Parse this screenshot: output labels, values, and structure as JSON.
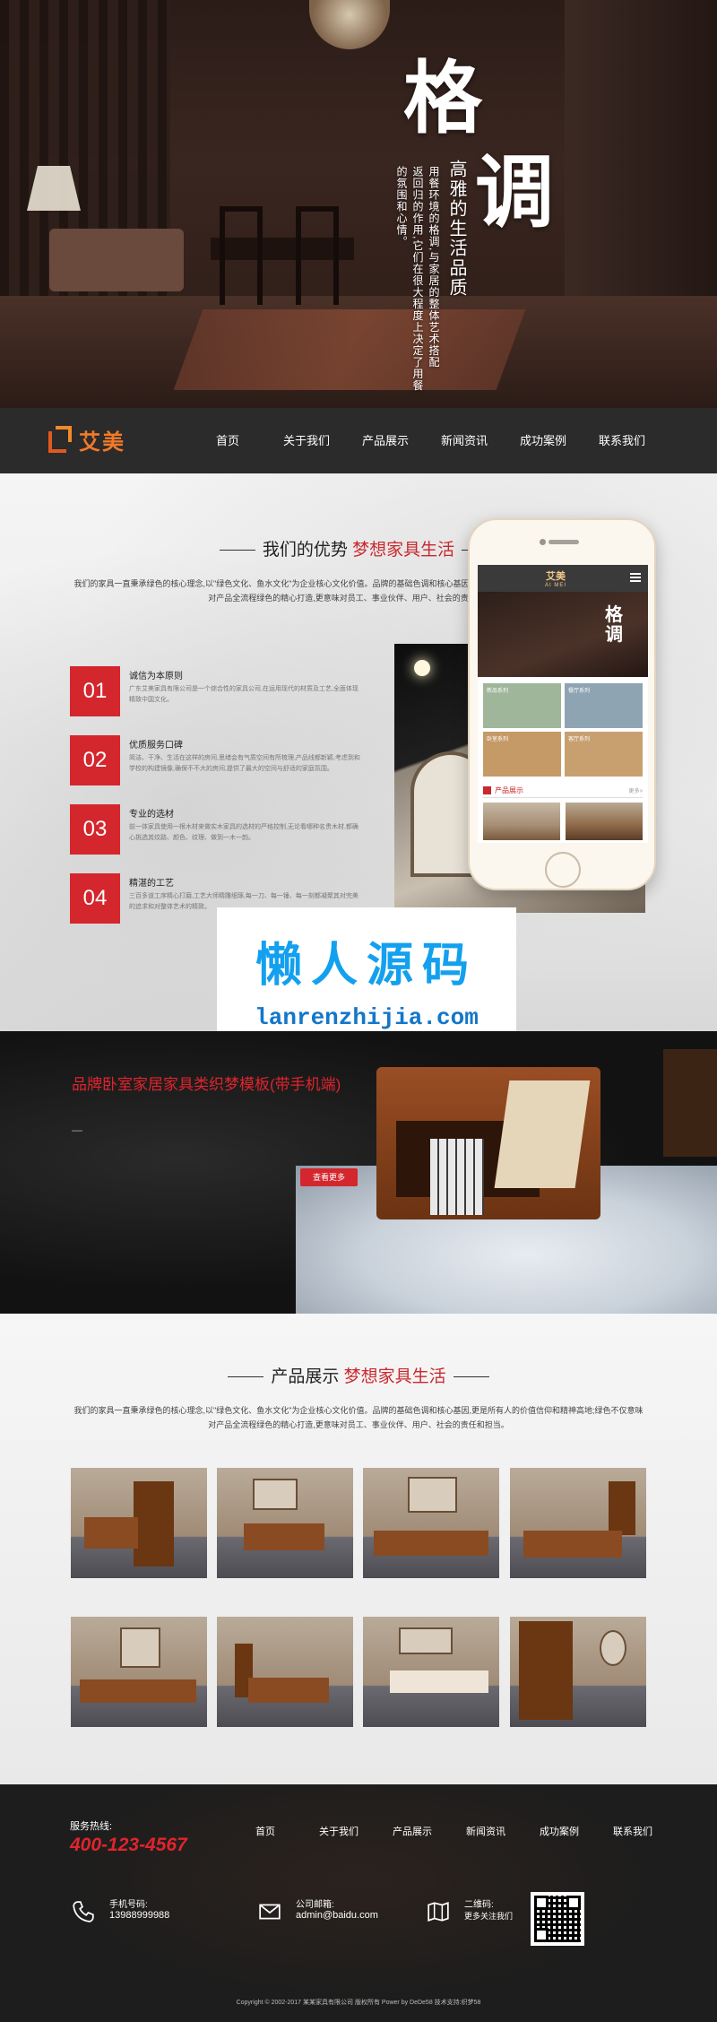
{
  "hero": {
    "title_char_1": "格",
    "title_char_2": "调",
    "subtitle": "高雅的生活品质",
    "text_lines": [
      "用餐环境的格调,与家居的整体艺术搭配",
      "返回归的作用,它们在很大程度上决定了用餐",
      "的氛围和心情。"
    ]
  },
  "nav": {
    "logo_text": "艾美",
    "items": [
      "首页",
      "关于我们",
      "产品展示",
      "新闻资讯",
      "成功案例",
      "联系我们"
    ]
  },
  "advantage": {
    "heading_main": "我们的优势",
    "heading_accent": "梦想家具生活",
    "intro": "我们的家具一直秉承绿色的核心理念,以\"绿色文化、鱼水文化\"为企业核心文化价值。品牌的基础色调和核心基因,更是所有人的价值信仰和精神高地;绿色不仅意味对产品全流程绿色的精心打造,更意味对员工、事业伙伴、用户、社会的责任和担当。",
    "features": [
      {
        "num": "01",
        "title": "诚信为本原则",
        "desc": "广东艾美家具有限公司是一个综合性的家具公司,在运用现代的材质及工艺,全面体现精致中国文化。"
      },
      {
        "num": "02",
        "title": "优质服务口碑",
        "desc": "简洁、干净、生活在这样的房间,思绪会有气质空间有所梳理,产品线都新颖,考虑到和学校的构建镜像,确保不不大的房间,提供了最大的空间与舒适的家庭氛围。"
      },
      {
        "num": "03",
        "title": "专业的选材",
        "desc": "前一体家具使用一根木材来做实木家具的选材的严格控制,无论看哪种名贵木材,都确心挑选其纹路、颜色、纹理、做到一木一韵。"
      },
      {
        "num": "04",
        "title": "精湛的工艺",
        "desc": "三百多道工序精心打磨,工艺大师精雕细琢,每一刀、每一锤、每一刻都凝聚其对完美的追求和对整体艺术的精致。"
      }
    ]
  },
  "phone": {
    "logo": "艾美",
    "logo_sub": "AI MEI",
    "hero_text": "格调",
    "tiles": [
      "新品系列",
      "餐厅系列",
      "卧室系列",
      "客厅系列"
    ],
    "section_label": "产品展示",
    "more": "更多>"
  },
  "watermark": {
    "cn": "懒人源码",
    "en": "lanrenzhijia.com"
  },
  "banner": {
    "title": "品牌卧室家居家具类织梦模板(带手机端)",
    "sub": "—",
    "button": "查看更多"
  },
  "products": {
    "heading_main": "产品展示",
    "heading_accent": "梦想家具生活",
    "intro": "我们的家具一直秉承绿色的核心理念,以\"绿色文化、鱼水文化\"为企业核心文化价值。品牌的基础色调和核心基因,更是所有人的价值信仰和精神高地;绿色不仅意味对产品全流程绿色的精心打造,更意味对员工、事业伙伴、用户、社会的责任和担当。"
  },
  "footer": {
    "hotline_label": "服务热线:",
    "hotline": "400-123-4567",
    "menu": [
      "首页",
      "关于我们",
      "产品展示",
      "新闻资讯",
      "成功案例",
      "联系我们"
    ],
    "phone_label": "手机号码:",
    "phone": "13988999988",
    "email_label": "公司邮箱:",
    "email": "admin@baidu.com",
    "qr_label": "二维码:",
    "qr_text": "更多关注我们",
    "copyright": "Copyright © 2002-2017 某某家具有限公司 版权所有 Power by DeDe58 技术支持:织梦58"
  },
  "colors": {
    "accent_red": "#d4262d",
    "logo_orange": "#f17a29",
    "nav_bg": "#2b2b2b",
    "watermark_blue": "#13a0ee"
  }
}
